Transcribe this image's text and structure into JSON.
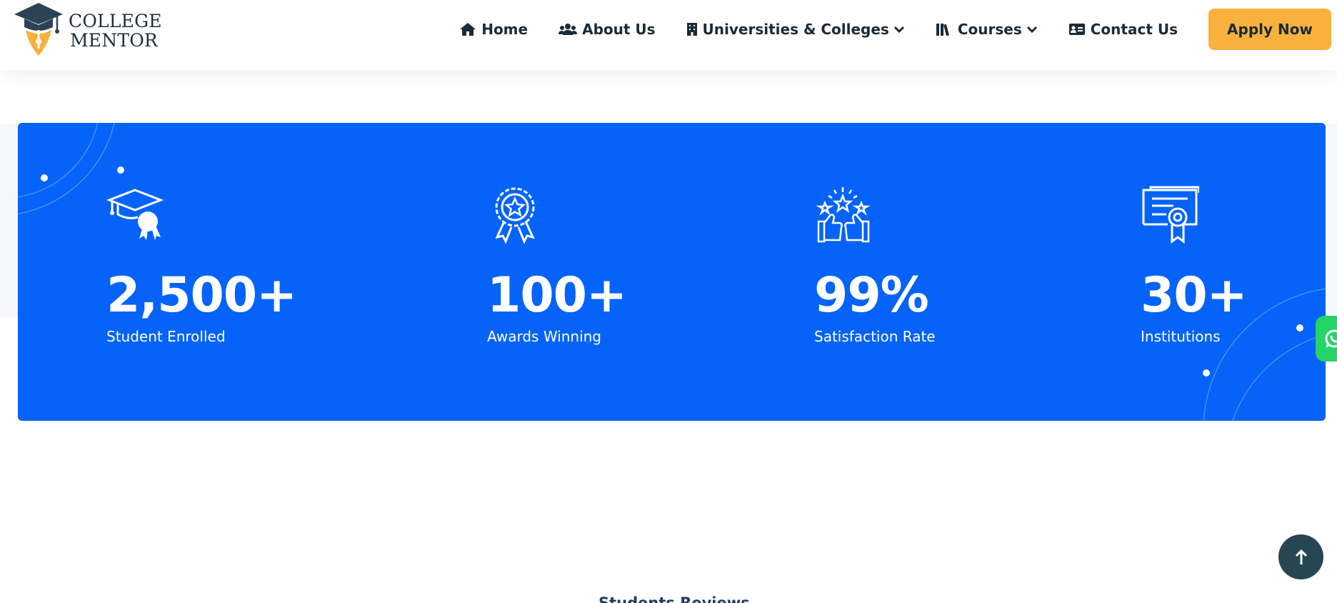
{
  "logo": {
    "line1": "COLLEGE",
    "line2": "MENTOR"
  },
  "nav": {
    "items": [
      {
        "label": "Home",
        "icon": "home-icon"
      },
      {
        "label": "About Us",
        "icon": "users-icon"
      },
      {
        "label": "Universities & Colleges",
        "icon": "building-icon",
        "dropdown": true
      },
      {
        "label": "Courses",
        "icon": "books-icon",
        "dropdown": true
      },
      {
        "label": "Contact Us",
        "icon": "contact-card-icon"
      }
    ],
    "cta": "Apply Now"
  },
  "stats": [
    {
      "value": "2,500+",
      "label": "Student Enrolled",
      "icon": "graduation-cap-icon"
    },
    {
      "value": "100+",
      "label": "Awards Winning",
      "icon": "award-ribbon-icon"
    },
    {
      "value": "99%",
      "label": "Satisfaction Rate",
      "icon": "thumbs-up-stars-icon"
    },
    {
      "value": "30+",
      "label": "Institutions",
      "icon": "certificate-icon"
    }
  ],
  "section": {
    "label": "Students Reviews"
  },
  "colors": {
    "primary": "#0563f9",
    "accent": "#f8b13d",
    "text": "#1b2a38",
    "whatsapp": "#25d366",
    "scroll_top": "#264653"
  }
}
